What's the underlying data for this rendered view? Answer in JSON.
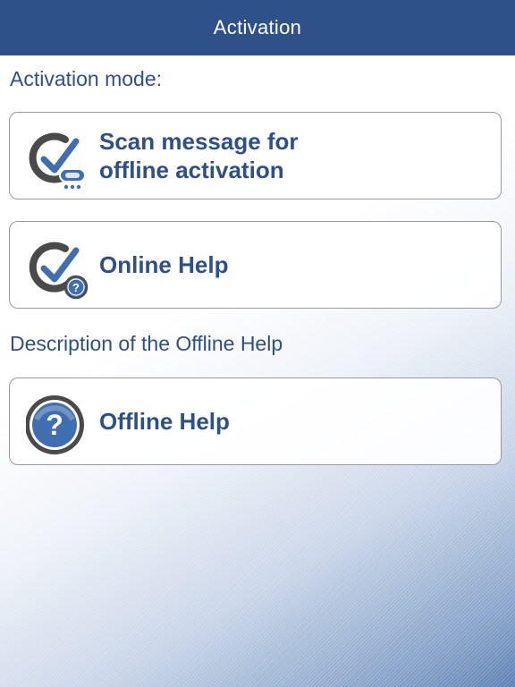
{
  "nav": {
    "title": "Activation"
  },
  "sections": {
    "activation_mode_label": "Activation mode:",
    "offline_help_description_label": "Description of the Offline Help"
  },
  "buttons": {
    "scan_message": {
      "label": "Scan message for\noffline activation",
      "icon": "check-with-token-icon"
    },
    "online_help": {
      "label": "Online Help",
      "icon": "check-with-question-icon"
    },
    "offline_help": {
      "label": "Offline Help",
      "icon": "question-circle-icon"
    }
  },
  "colors": {
    "nav_background": "#2f5189",
    "accent_text": "#2d5088",
    "check_blue": "#3f6fb0",
    "ring_gray": "#4a4a4a"
  }
}
